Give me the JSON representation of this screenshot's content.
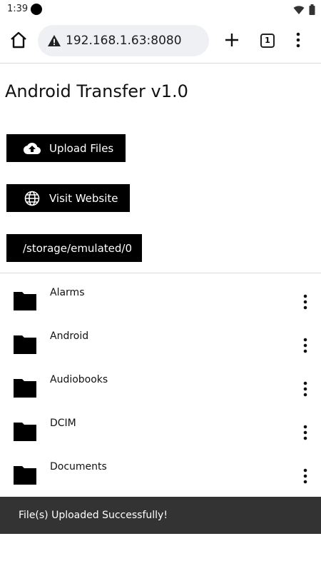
{
  "status_bar": {
    "time": "1:39",
    "icons": [
      "record-dot-icon",
      "wifi-icon",
      "battery-icon"
    ]
  },
  "browser": {
    "url": "192.168.1.63:8080",
    "tab_count": "1",
    "icons": [
      "home-icon",
      "warning-icon",
      "plus-icon",
      "tabs-icon",
      "more-vert-icon"
    ]
  },
  "page": {
    "title": "Android Transfer v1.0",
    "upload_label": "Upload Files",
    "visit_label": "Visit Website",
    "path_label": "/storage/emulated/0"
  },
  "files": [
    {
      "name": "Alarms",
      "icon": "folder-icon"
    },
    {
      "name": "Android",
      "icon": "folder-icon"
    },
    {
      "name": "Audiobooks",
      "icon": "folder-icon"
    },
    {
      "name": "DCIM",
      "icon": "folder-icon"
    },
    {
      "name": "Documents",
      "icon": "folder-icon"
    }
  ],
  "snackbar": {
    "message": "File(s) Uploaded Successfully!"
  },
  "colors": {
    "button_bg": "#000000",
    "button_text": "#ffffff",
    "snackbar_bg": "#333333",
    "url_bar_bg": "#eef0f4"
  }
}
